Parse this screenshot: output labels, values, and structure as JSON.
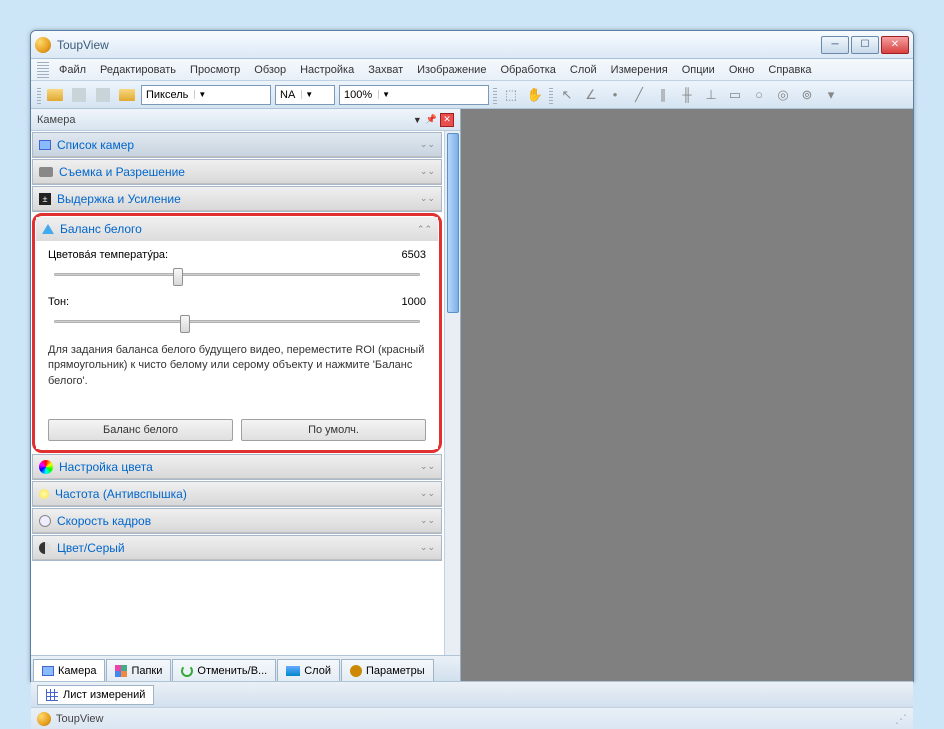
{
  "app": {
    "title": "ToupView",
    "status": "ToupView"
  },
  "menu": [
    "Файл",
    "Редактировать",
    "Просмотр",
    "Обзор",
    "Настройка",
    "Захват",
    "Изображение",
    "Обработка",
    "Слой",
    "Измерения",
    "Опции",
    "Окно",
    "Справка"
  ],
  "toolbar": {
    "unit": "Пиксель",
    "na": "NA",
    "zoom": "100%"
  },
  "panel": {
    "caption": "Камера"
  },
  "acc": {
    "list": "Список камер",
    "capture": "Съемка и Разрешение",
    "exposure": "Выдержка и Усиление",
    "wb": "Баланс белого",
    "color": "Настройка цвета",
    "freq": "Частота (Антивспышка)",
    "speed": "Скорость кадров",
    "gray": "Цвет/Серый"
  },
  "wb": {
    "temp_label": "Цветова́я температу́ра:",
    "temp_val": "6503",
    "tone_label": "Тон:",
    "tone_val": "1000",
    "help": "Для задания баланса белого будущего видео, переместите ROI (красный прямоугольник) к чисто белому или серому объекту и нажмите 'Баланс белого'.",
    "btn_wb": "Баланс белого",
    "btn_def": "По умолч."
  },
  "tabs": {
    "camera": "Камера",
    "folders": "Папки",
    "undo": "Отменить/В...",
    "layer": "Слой",
    "params": "Параметры"
  },
  "bottom": {
    "sheet": "Лист измерений"
  }
}
